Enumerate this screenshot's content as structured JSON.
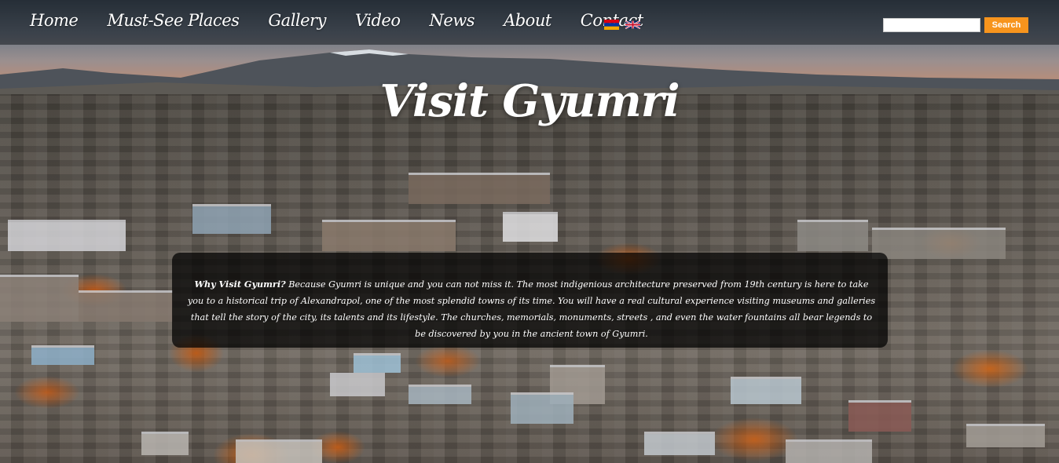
{
  "nav": {
    "items": [
      "Home",
      "Must-See Places",
      "Gallery",
      "Video",
      "News",
      "About",
      "Contact"
    ],
    "flags": [
      "armenia-flag-icon",
      "uk-flag-icon"
    ]
  },
  "search": {
    "value": "",
    "placeholder": "",
    "button_label": "Search",
    "button_color": "#f7941d"
  },
  "hero": {
    "title": "Visit Gyumri"
  },
  "intro": {
    "lead": "Why Visit Gyumri?",
    "text": " Because Gyumri is unique and you can not miss it. The most indigenious architecture preserved from 19th century is here to take you to a historical trip of Alexandrapol, one of the most splendid towns of its time. You will have a real cultural experience visiting museums and galleries that tell the story of the city, its talents and its lifestyle. The churches, memorials, monuments, streets , and even the water fountains all bear legends to be discovered by you in the ancient town of Gyumri."
  }
}
